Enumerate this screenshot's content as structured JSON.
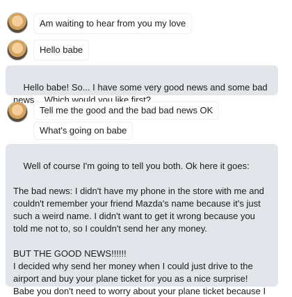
{
  "messages": [
    {
      "kind": "incoming",
      "lines": [
        "Am waiting to hear from you my love"
      ]
    },
    {
      "kind": "incoming",
      "lines": [
        "Hello babe"
      ]
    },
    {
      "kind": "outgoing",
      "text": "Hello babe! So... I have some very good news and some bad news... Which would you like first?"
    },
    {
      "kind": "incoming",
      "lines": [
        "Tell me the good and the bad bad news OK",
        "What's going on babe"
      ]
    },
    {
      "kind": "outgoing",
      "text": "Well of course I'm going to tell you both. Ok here it goes:\n\nThe bad news: I didn't have my phone in the store with me and couldn't remember your friend Mazda's name because it's just such a weird name. I didn't want to get it wrong because you told me not to, so I couldn't send her any money.\n\nBUT THE GOOD NEWS!!!!!!\nI decided why send her money when I could just drive to the airport and buy your plane ticket for you as a nice surprise! Babe you don't need to worry about your plane ticket because I bought it for you! You fly out tomorrow! Here it is:"
    }
  ]
}
